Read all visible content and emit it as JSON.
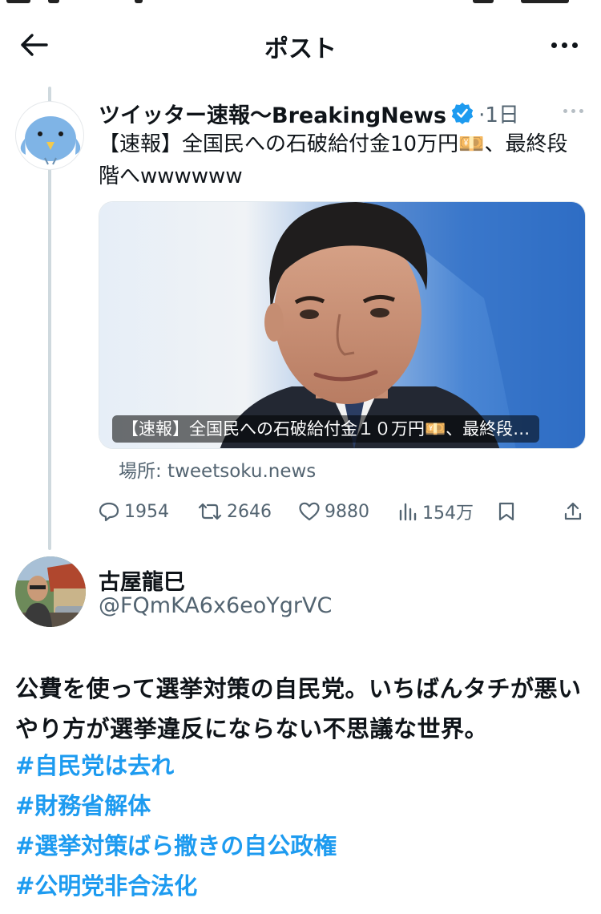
{
  "header": {
    "title": "ポスト"
  },
  "parent_post": {
    "author_name": "ツイッター速報〜BreakingNews",
    "time": "·1日",
    "text": "【速報】全国民への石破給付金10万円💴、最終段階へwwwwww",
    "card": {
      "caption": "【速報】全国民への石破給付金１０万円💴、最終段…",
      "source": "場所: tweetsoku.news"
    },
    "stats": {
      "replies": "1954",
      "reposts": "2646",
      "likes": "9880",
      "views": "154万"
    }
  },
  "post": {
    "author_name": "古屋龍巳",
    "handle": "@FQmKA6x6eoYgrVC",
    "text": "公費を使って選挙対策の自民党。いちばんタチが悪いやり方が選挙違反にならない不思議な世界。",
    "hashtags": [
      "#自民党は去れ",
      "#財務省解体",
      "#選挙対策ばら撒きの自公政権",
      "#公明党非合法化"
    ]
  },
  "colors": {
    "accent": "#1d9bf0",
    "muted": "#536471",
    "text": "#0f1419"
  }
}
